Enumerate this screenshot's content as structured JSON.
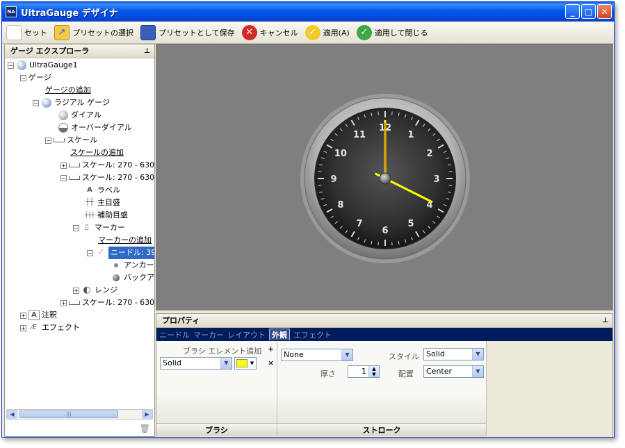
{
  "window": {
    "title": "UltraGauge デザイナ",
    "app_icon_text": "NA",
    "controls": {
      "minimize": "_",
      "maximize": "□",
      "close": "✕"
    }
  },
  "toolbar": {
    "reset": "セット",
    "select_preset": "プリセットの選択",
    "save_preset": "プリセットとして保存",
    "cancel": "キャンセル",
    "apply": "適用(A)",
    "apply_close": "適用して閉じる"
  },
  "explorer": {
    "title": "ゲージ エクスプローラ",
    "tree": {
      "root": "UltraGauge1",
      "gauges": "ゲージ",
      "add_gauge": "ゲージの追加",
      "radial_gauge": "ラジアル ゲージ",
      "dial": "ダイアル",
      "overdial": "オーバーダイアル",
      "scales": "スケール",
      "add_scale": "スケールの追加",
      "scale1": "スケール: 270 - 630",
      "scale2": "スケール: 270 - 630",
      "label": "ラベル",
      "major_ticks": "主目盛",
      "minor_ticks": "補助目盛",
      "markers": "マーカー",
      "add_marker": "マーカーの追加",
      "needle": "ニードル: 39",
      "anchor": "アンカー",
      "back": "バックア",
      "ranges": "レンジ",
      "scale3": "スケール: 270 - 630",
      "annotations": "注釈",
      "effects": "エフェクト"
    }
  },
  "clock": {
    "numbers": [
      "12",
      "1",
      "2",
      "3",
      "4",
      "5",
      "6",
      "7",
      "8",
      "9",
      "10",
      "11"
    ],
    "time": {
      "hour_hand_value": 4,
      "minute_hand_value": 12
    }
  },
  "properties": {
    "title": "プロパティ",
    "tabs": [
      "ニードル",
      "マーカー",
      "レイアウト",
      "外観",
      "エフェクト"
    ],
    "active_tab": "外観",
    "brush": {
      "add_element_label": "ブラシ エレメント追加",
      "type_value": "Solid",
      "color": "#ffff00",
      "footer": "ブラシ"
    },
    "stroke": {
      "brush_value": "None",
      "style_label": "スタイル",
      "style_value": "Solid",
      "thickness_label": "厚さ",
      "thickness_value": "1",
      "placement_label": "配置",
      "placement_value": "Center",
      "footer": "ストローク"
    }
  }
}
